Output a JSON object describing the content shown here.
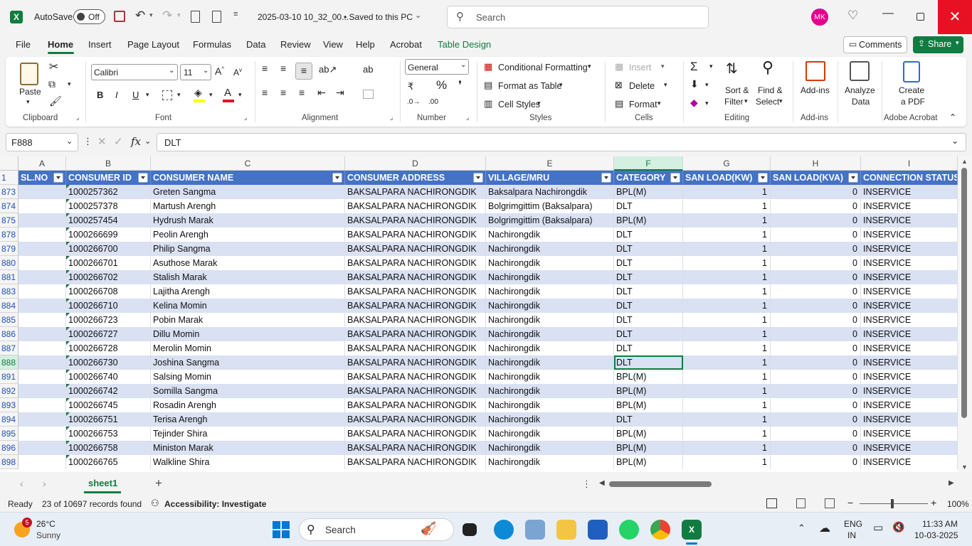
{
  "titlebar": {
    "autosave_label": "AutoSave",
    "autosave_state": "Off",
    "filename": "2025-03-10 10_32_00...",
    "save_status": "• Saved to this PC",
    "search_placeholder": "Search",
    "user_initials": "MK"
  },
  "menu": [
    "File",
    "Home",
    "Insert",
    "Page Layout",
    "Formulas",
    "Data",
    "Review",
    "View",
    "Help",
    "Acrobat",
    "Table Design"
  ],
  "menu_active": "Home",
  "comments_label": "Comments",
  "share_label": "Share",
  "ribbon": {
    "clipboard": {
      "label": "Clipboard",
      "paste": "Paste"
    },
    "font": {
      "label": "Font",
      "name": "Calibri",
      "size": "11",
      "bold": "B",
      "italic": "I",
      "underline": "U"
    },
    "alignment": {
      "label": "Alignment"
    },
    "number": {
      "label": "Number",
      "format": "General"
    },
    "styles": {
      "label": "Styles",
      "conditional": "Conditional Formatting",
      "format_table": "Format as Table",
      "cell_styles": "Cell Styles"
    },
    "cells": {
      "label": "Cells",
      "insert": "Insert",
      "delete": "Delete",
      "format": "Format"
    },
    "editing": {
      "label": "Editing",
      "sort_filter_1": "Sort &",
      "sort_filter_2": "Filter",
      "find_select_1": "Find &",
      "find_select_2": "Select"
    },
    "addins": {
      "label": "Add-ins",
      "addins_btn": "Add-ins",
      "analyze_1": "Analyze",
      "analyze_2": "Data"
    },
    "acrobat": {
      "label": "Adobe Acrobat",
      "create_1": "Create",
      "create_2": "a PDF"
    }
  },
  "formula": {
    "name_box": "F888",
    "fx": "fx",
    "value": "DLT"
  },
  "columns": [
    "A",
    "B",
    "C",
    "D",
    "E",
    "F",
    "G",
    "H",
    "I"
  ],
  "selected_column": "F",
  "header_row_number": "1",
  "headers": [
    "SL.NO",
    "CONSUMER ID",
    "CONSUMER NAME",
    "CONSUMER ADDRESS",
    "VILLAGE/MRU",
    "CATEGORY",
    "SAN LOAD(KW)",
    "SAN LOAD(KVA)",
    "CONNECTION STATUS"
  ],
  "rows": [
    {
      "n": "873",
      "id": "1000257362",
      "name": "Greten Sangma",
      "addr": "BAKSALPARA NACHIRONGDIK",
      "village": "Baksalpara Nachirongdik",
      "cat": "BPL(M)",
      "kw": "1",
      "kva": "0",
      "status": "INSERVICE"
    },
    {
      "n": "874",
      "id": "1000257378",
      "name": "Martush Arengh",
      "addr": "BAKSALPARA NACHIRONGDIK",
      "village": "Bolgrimgittim (Baksalpara)",
      "cat": "DLT",
      "kw": "1",
      "kva": "0",
      "status": "INSERVICE"
    },
    {
      "n": "875",
      "id": "1000257454",
      "name": "Hydrush Marak",
      "addr": "BAKSALPARA NACHIRONGDIK",
      "village": "Bolgrimgittim (Baksalpara)",
      "cat": "BPL(M)",
      "kw": "1",
      "kva": "0",
      "status": "INSERVICE"
    },
    {
      "n": "878",
      "id": "1000266699",
      "name": "Peolin Arengh",
      "addr": "BAKSALPARA NACHIRONGDIK",
      "village": "Nachirongdik",
      "cat": "DLT",
      "kw": "1",
      "kva": "0",
      "status": "INSERVICE"
    },
    {
      "n": "879",
      "id": "1000266700",
      "name": "Philip Sangma",
      "addr": "BAKSALPARA NACHIRONGDIK",
      "village": "Nachirongdik",
      "cat": "DLT",
      "kw": "1",
      "kva": "0",
      "status": "INSERVICE"
    },
    {
      "n": "880",
      "id": "1000266701",
      "name": "Asuthose Marak",
      "addr": "BAKSALPARA NACHIRONGDIK",
      "village": "Nachirongdik",
      "cat": "DLT",
      "kw": "1",
      "kva": "0",
      "status": "INSERVICE"
    },
    {
      "n": "881",
      "id": "1000266702",
      "name": "Stalish Marak",
      "addr": "BAKSALPARA NACHIRONGDIK",
      "village": "Nachirongdik",
      "cat": "DLT",
      "kw": "1",
      "kva": "0",
      "status": "INSERVICE"
    },
    {
      "n": "883",
      "id": "1000266708",
      "name": "Lajitha Arengh",
      "addr": "BAKSALPARA NACHIRONGDIK",
      "village": "Nachirongdik",
      "cat": "DLT",
      "kw": "1",
      "kva": "0",
      "status": "INSERVICE"
    },
    {
      "n": "884",
      "id": "1000266710",
      "name": "Kelina Momin",
      "addr": "BAKSALPARA NACHIRONGDIK",
      "village": "Nachirongdik",
      "cat": "DLT",
      "kw": "1",
      "kva": "0",
      "status": "INSERVICE"
    },
    {
      "n": "885",
      "id": "1000266723",
      "name": "Pobin Marak",
      "addr": "BAKSALPARA NACHIRONGDIK",
      "village": "Nachirongdik",
      "cat": "DLT",
      "kw": "1",
      "kva": "0",
      "status": "INSERVICE"
    },
    {
      "n": "886",
      "id": "1000266727",
      "name": "Dillu Momin",
      "addr": "BAKSALPARA NACHIRONGDIK",
      "village": "Nachirongdik",
      "cat": "DLT",
      "kw": "1",
      "kva": "0",
      "status": "INSERVICE"
    },
    {
      "n": "887",
      "id": "1000266728",
      "name": "Merolin Momin",
      "addr": "BAKSALPARA NACHIRONGDIK",
      "village": "Nachirongdik",
      "cat": "DLT",
      "kw": "1",
      "kva": "0",
      "status": "INSERVICE"
    },
    {
      "n": "888",
      "id": "1000266730",
      "name": "Joshina Sangma",
      "addr": "BAKSALPARA NACHIRONGDIK",
      "village": "Nachirongdik",
      "cat": "DLT",
      "kw": "1",
      "kva": "0",
      "status": "INSERVICE"
    },
    {
      "n": "891",
      "id": "1000266740",
      "name": "Salsing Momin",
      "addr": "BAKSALPARA NACHIRONGDIK",
      "village": "Nachirongdik",
      "cat": "BPL(M)",
      "kw": "1",
      "kva": "0",
      "status": "INSERVICE"
    },
    {
      "n": "892",
      "id": "1000266742",
      "name": "Somilla Sangma",
      "addr": "BAKSALPARA NACHIRONGDIK",
      "village": "Nachirongdik",
      "cat": "BPL(M)",
      "kw": "1",
      "kva": "0",
      "status": "INSERVICE"
    },
    {
      "n": "893",
      "id": "1000266745",
      "name": "Rosadin Arengh",
      "addr": "BAKSALPARA NACHIRONGDIK",
      "village": "Nachirongdik",
      "cat": "BPL(M)",
      "kw": "1",
      "kva": "0",
      "status": "INSERVICE"
    },
    {
      "n": "894",
      "id": "1000266751",
      "name": "Terisa Arengh",
      "addr": "BAKSALPARA NACHIRONGDIK",
      "village": "Nachirongdik",
      "cat": "DLT",
      "kw": "1",
      "kva": "0",
      "status": "INSERVICE"
    },
    {
      "n": "895",
      "id": "1000266753",
      "name": "Tejinder Shira",
      "addr": "BAKSALPARA NACHIRONGDIK",
      "village": "Nachirongdik",
      "cat": "BPL(M)",
      "kw": "1",
      "kva": "0",
      "status": "INSERVICE"
    },
    {
      "n": "896",
      "id": "1000266758",
      "name": "Ministon Marak",
      "addr": "BAKSALPARA NACHIRONGDIK",
      "village": "Nachirongdik",
      "cat": "BPL(M)",
      "kw": "1",
      "kva": "0",
      "status": "INSERVICE"
    },
    {
      "n": "898",
      "id": "1000266765",
      "name": "Walkline Shira",
      "addr": "BAKSALPARA NACHIRONGDIK",
      "village": "Nachirongdik",
      "cat": "BPL(M)",
      "kw": "1",
      "kva": "0",
      "status": "INSERVICE"
    }
  ],
  "active_row": "888",
  "sheet_tab": "sheet1",
  "status": {
    "ready": "Ready",
    "records": "23 of 10697 records found",
    "accessibility": "Accessibility: Investigate",
    "zoom": "100%"
  },
  "taskbar": {
    "weather_temp": "26°C",
    "weather_desc": "Sunny",
    "weather_badge": "5",
    "search": "Search",
    "lang1": "ENG",
    "lang2": "IN",
    "time": "11:33 AM",
    "date": "10-03-2025"
  },
  "colors": {
    "excel_green": "#107c41",
    "header_blue": "#4472c4",
    "band_blue": "#d9e1f2",
    "close_red": "#e81123"
  }
}
